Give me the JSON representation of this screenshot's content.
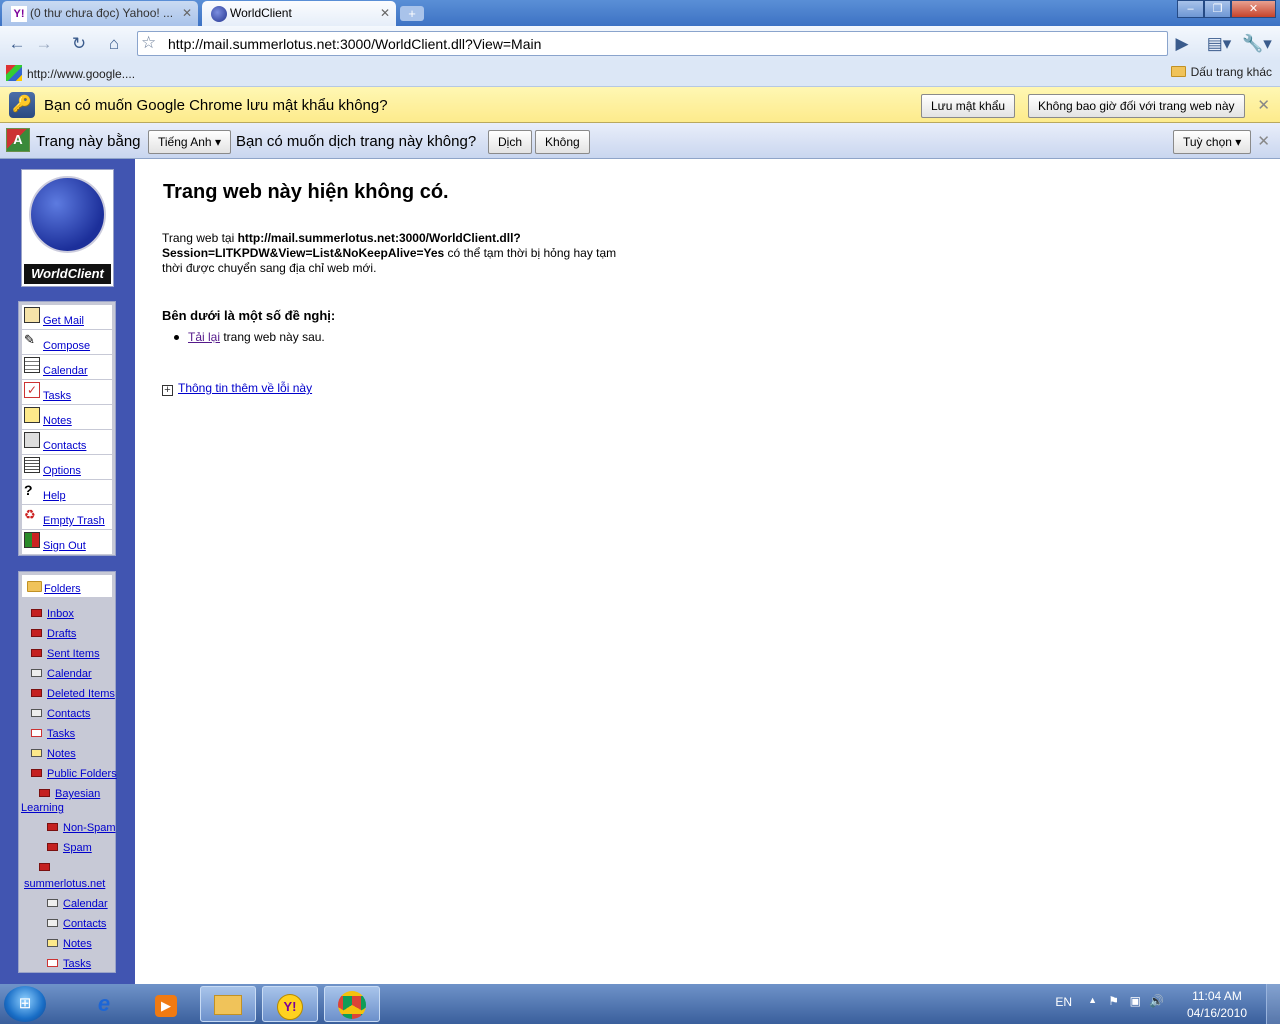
{
  "browser": {
    "tabs": [
      {
        "title": "(0 thư chưa đọc) Yahoo! ...",
        "active": false
      },
      {
        "title": "WorldClient",
        "active": true
      }
    ],
    "address": "http://mail.summerlotus.net:3000/WorldClient.dll?View=Main",
    "bookmarks": {
      "item": "http://www.google....",
      "other": "Dấu trang khác"
    },
    "password_bar": {
      "text": "Bạn có muốn Google Chrome lưu mật khẩu không?",
      "save": "Lưu mật khẩu",
      "never": "Không bao giờ đối với trang web này"
    },
    "translate_bar": {
      "text1": "Trang này bằng",
      "language": "Tiếng Anh",
      "text2": "Bạn có muốn dịch trang này không?",
      "translate": "Dịch",
      "no": "Không",
      "options": "Tuỳ chọn"
    }
  },
  "sidebar": {
    "logo_text": "WorldClient",
    "menu": [
      "Get Mail",
      "Compose",
      "Calendar",
      "Tasks",
      "Notes",
      "Contacts",
      "Options",
      "Help",
      "Empty Trash",
      "Sign Out"
    ],
    "folders_label": "Folders",
    "folders": [
      "Inbox",
      "Drafts",
      "Sent Items",
      "Calendar",
      "Deleted Items",
      "Contacts",
      "Tasks",
      "Notes",
      "Public Folders",
      "Bayesian",
      "Learning",
      "Non-Spam",
      "Spam",
      "summerlotus.net",
      "Calendar",
      "Contacts",
      "Notes",
      "Tasks"
    ]
  },
  "error": {
    "title": "Trang web này hiện không có.",
    "p_prefix": "Trang web tại ",
    "p_url_1": "http://mail.summerlotus.net:3000/WorldClient.dll?",
    "p_url_2": "Session=LITKPDW&View=List&NoKeepAlive=Yes",
    "p_suffix": " có thể tạm thời bị hỏng hay tạm thời được chuyển sang địa chỉ web mới.",
    "suggest_head": "Bên dưới là một số đề nghị:",
    "reload_link": "Tải lại",
    "reload_rest": " trang web này sau.",
    "more": "Thông tin thêm về lỗi này"
  },
  "taskbar": {
    "lang": "EN",
    "time": "11:04 AM",
    "date": "04/16/2010"
  }
}
